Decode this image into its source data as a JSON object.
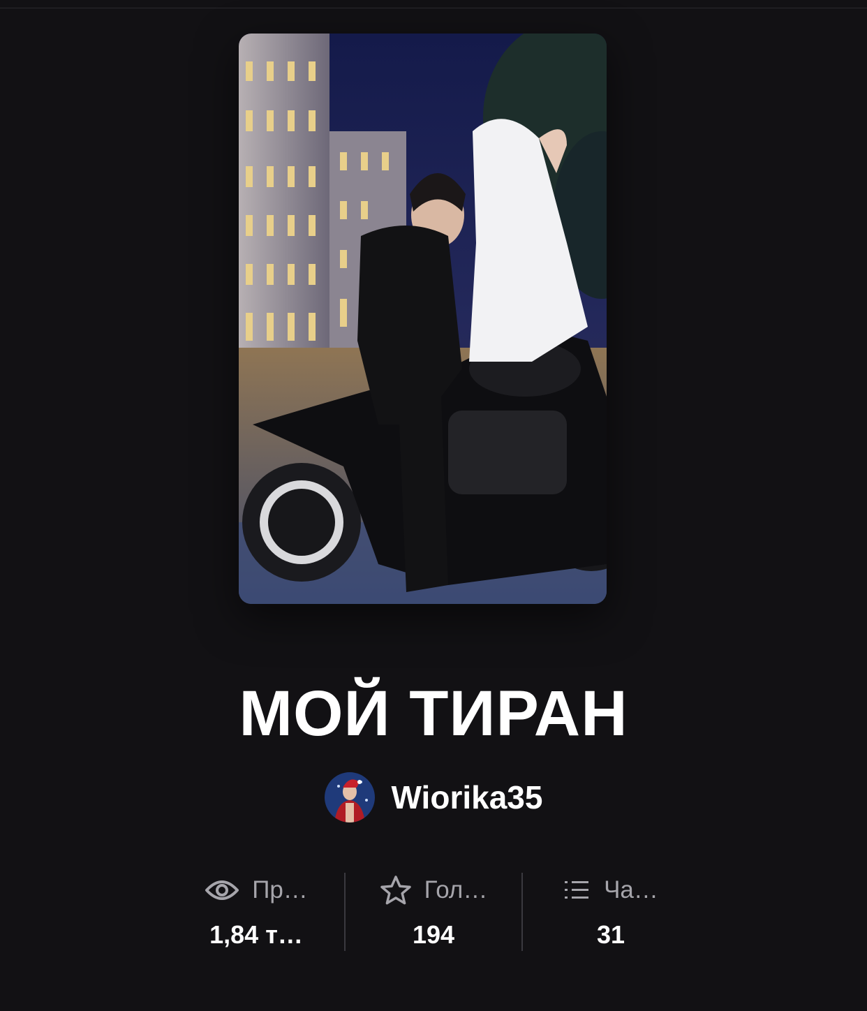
{
  "story": {
    "title": "МОЙ ТИРАН",
    "cover_alt": "cover image"
  },
  "author": {
    "name": "Wiorika35"
  },
  "stats": [
    {
      "icon": "eye-icon",
      "label": "Пр…",
      "value": "1,84 т…"
    },
    {
      "icon": "star-icon",
      "label": "Гол…",
      "value": "194"
    },
    {
      "icon": "list-icon",
      "label": "Ча…",
      "value": "31"
    }
  ],
  "colors": {
    "background": "#121114",
    "text": "#ffffff",
    "muted": "#a6a5ab",
    "separator": "#3a393f"
  }
}
